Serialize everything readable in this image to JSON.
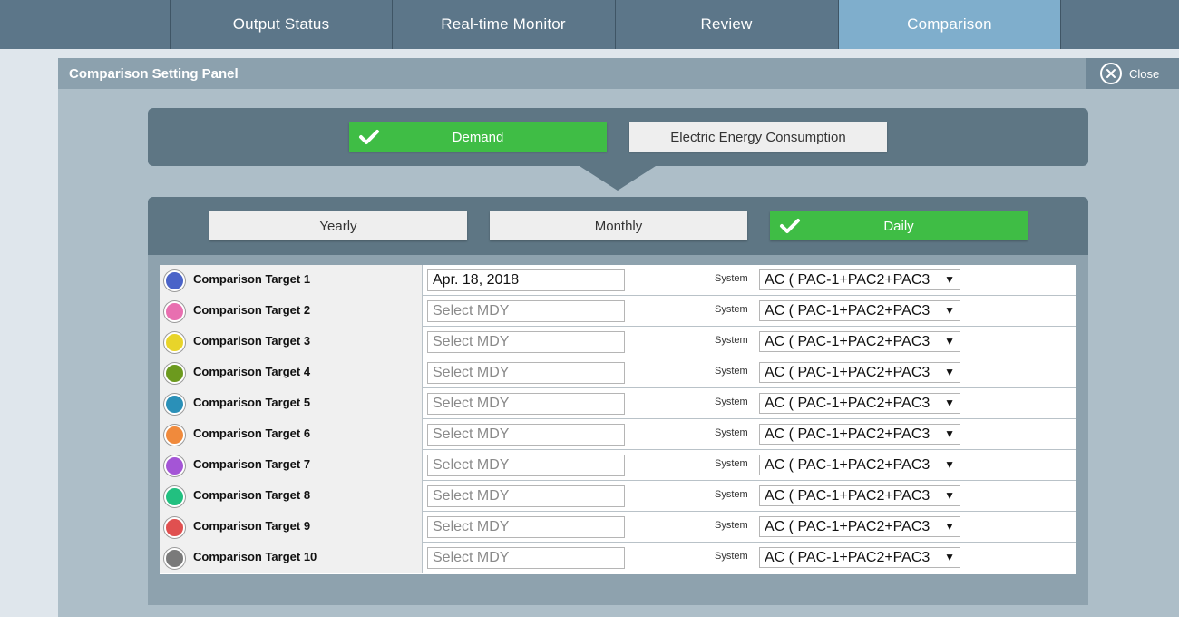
{
  "tabs": [
    {
      "label": "Output Status",
      "active": false
    },
    {
      "label": "Real-time Monitor",
      "active": false
    },
    {
      "label": "Review",
      "active": false
    },
    {
      "label": "Comparison",
      "active": true
    }
  ],
  "panel": {
    "title": "Comparison Setting Panel",
    "close_label": "Close"
  },
  "type_selector": {
    "demand_label": "Demand",
    "energy_label": "Electric Energy Consumption",
    "selected": "Demand"
  },
  "period_selector": {
    "yearly_label": "Yearly",
    "monthly_label": "Monthly",
    "daily_label": "Daily",
    "selected": "Daily"
  },
  "table": {
    "system_label": "System",
    "date_placeholder": "Select MDY",
    "rows": [
      {
        "name": "Comparison Target 1",
        "color": "#4a63c8",
        "date": "Apr. 18, 2018",
        "system": "AC ( PAC-1+PAC2+PAC3"
      },
      {
        "name": "Comparison Target 2",
        "color": "#e86fb0",
        "date": "",
        "system": "AC ( PAC-1+PAC2+PAC3"
      },
      {
        "name": "Comparison Target 3",
        "color": "#e8d42a",
        "date": "",
        "system": "AC ( PAC-1+PAC2+PAC3"
      },
      {
        "name": "Comparison Target 4",
        "color": "#6c9a1e",
        "date": "",
        "system": "AC ( PAC-1+PAC2+PAC3"
      },
      {
        "name": "Comparison Target 5",
        "color": "#2a90b8",
        "date": "",
        "system": "AC ( PAC-1+PAC2+PAC3"
      },
      {
        "name": "Comparison Target 6",
        "color": "#f08a3c",
        "date": "",
        "system": "AC ( PAC-1+PAC2+PAC3"
      },
      {
        "name": "Comparison Target 7",
        "color": "#a455d6",
        "date": "",
        "system": "AC ( PAC-1+PAC2+PAC3"
      },
      {
        "name": "Comparison Target 8",
        "color": "#22c080",
        "date": "",
        "system": "AC ( PAC-1+PAC2+PAC3"
      },
      {
        "name": "Comparison Target 9",
        "color": "#e05050",
        "date": "",
        "system": "AC ( PAC-1+PAC2+PAC3"
      },
      {
        "name": "Comparison Target 10",
        "color": "#7a7a7a",
        "date": "",
        "system": "AC ( PAC-1+PAC2+PAC3"
      }
    ]
  }
}
